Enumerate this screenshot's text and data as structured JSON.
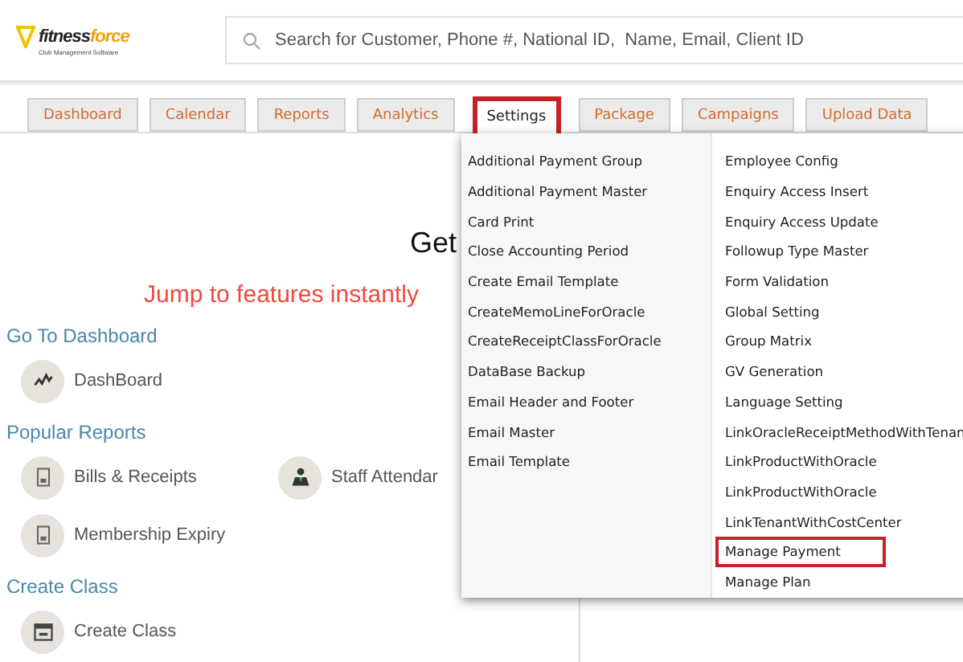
{
  "logo": {
    "first": "fitness",
    "second": "force",
    "tagline": "Club Management Software"
  },
  "search": {
    "placeholder": "Search for Customer, Phone #, National ID,  Name, Email, Client ID"
  },
  "tabs": [
    {
      "label": "Dashboard",
      "selected": false
    },
    {
      "label": "Calendar",
      "selected": false
    },
    {
      "label": "Reports",
      "selected": false
    },
    {
      "label": "Analytics",
      "selected": false
    },
    {
      "label": "Settings",
      "selected": true
    },
    {
      "label": "Package",
      "selected": false
    },
    {
      "label": "Campaigns",
      "selected": false
    },
    {
      "label": "Upload Data",
      "selected": false
    }
  ],
  "page": {
    "title": "Get",
    "subtitle": "Jump to features instantly"
  },
  "sections": [
    {
      "heading": "Go To Dashboard",
      "items": [
        {
          "label": "DashBoard",
          "kind": "chart"
        }
      ]
    },
    {
      "heading": "Popular Reports",
      "items": [
        {
          "label": "Bills & Receipts",
          "kind": "report"
        },
        {
          "label": "Staff Attendar",
          "kind": "staff"
        },
        {
          "label": "Membership Expiry",
          "kind": "report"
        }
      ]
    },
    {
      "heading": "Create Class",
      "items": [
        {
          "label": "Create Class",
          "kind": "calendar"
        }
      ]
    }
  ],
  "menu": {
    "columns": [
      [
        {
          "label": "Additional Payment Group",
          "highlighted": false
        },
        {
          "label": "Additional Payment Master",
          "highlighted": false
        },
        {
          "label": "Card Print",
          "highlighted": false
        },
        {
          "label": "Close Accounting Period",
          "highlighted": false
        },
        {
          "label": "Create Email Template",
          "highlighted": false
        },
        {
          "label": "CreateMemoLineForOracle",
          "highlighted": false
        },
        {
          "label": "CreateReceiptClassForOracle",
          "highlighted": false
        },
        {
          "label": "DataBase Backup",
          "highlighted": false
        },
        {
          "label": "Email Header and Footer",
          "highlighted": false
        },
        {
          "label": "Email Master",
          "highlighted": false
        },
        {
          "label": "Email Template",
          "highlighted": false
        }
      ],
      [
        {
          "label": "Employee Config",
          "highlighted": false
        },
        {
          "label": "Enquiry Access Insert",
          "highlighted": false
        },
        {
          "label": "Enquiry Access Update",
          "highlighted": false
        },
        {
          "label": "Followup Type Master",
          "highlighted": false
        },
        {
          "label": "Form Validation",
          "highlighted": false
        },
        {
          "label": "Global Setting",
          "highlighted": false
        },
        {
          "label": "Group Matrix",
          "highlighted": false
        },
        {
          "label": "GV Generation",
          "highlighted": false
        },
        {
          "label": "Language Setting",
          "highlighted": false
        },
        {
          "label": "LinkOracleReceiptMethodWithTenan",
          "highlighted": false
        },
        {
          "label": "LinkProductWithOracle",
          "highlighted": false
        },
        {
          "label": "LinkProductWithOracle",
          "highlighted": false
        },
        {
          "label": "LinkTenantWithCostCenter",
          "highlighted": false
        },
        {
          "label": "Manage Payment",
          "highlighted": true
        },
        {
          "label": "Manage Plan",
          "highlighted": false
        }
      ]
    ]
  }
}
